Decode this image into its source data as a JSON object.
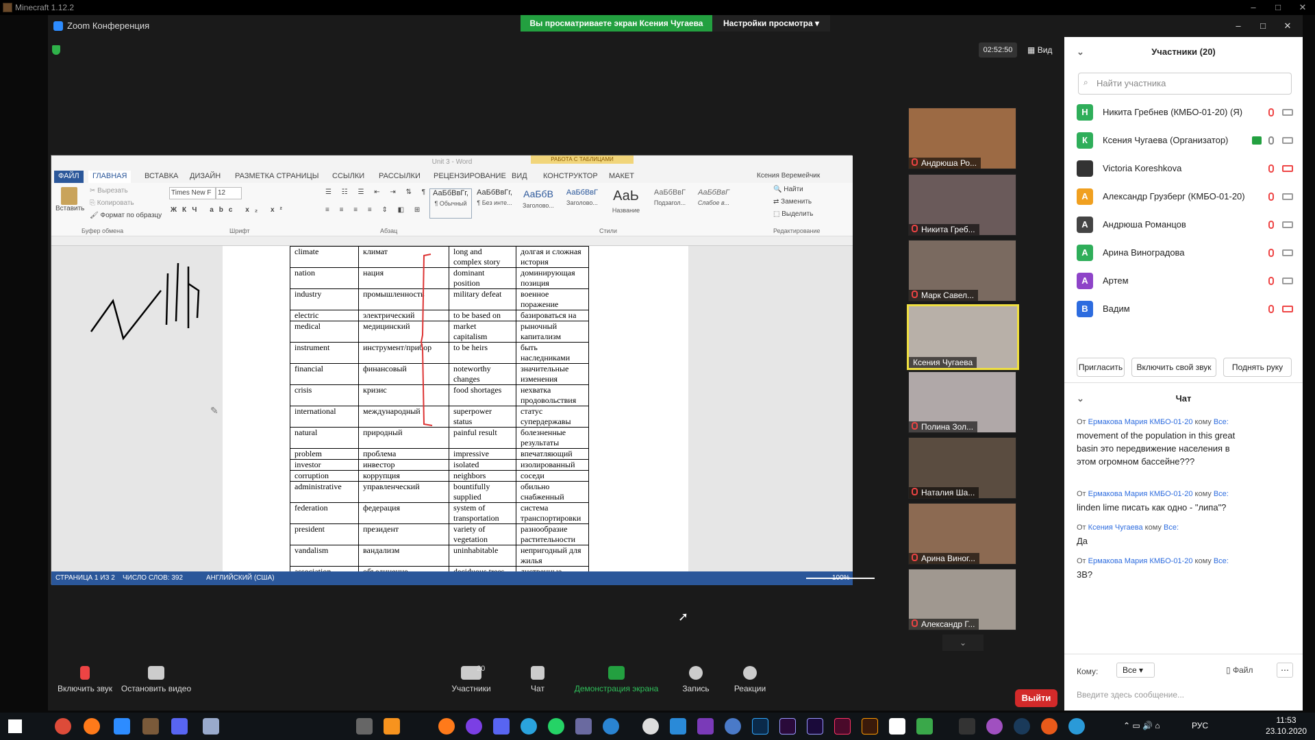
{
  "window": {
    "title": "Minecraft 1.12.2"
  },
  "zoom": {
    "title": "Zoom Конференция",
    "banner": "Вы просматриваете экран Ксения Чугаева",
    "view_settings": "Настройки просмотра",
    "timer": "02:52:50",
    "view": "Вид"
  },
  "word": {
    "title": "Unit 3 - Word",
    "ctx_tab": "РАБОТА С ТАБЛИЦАМИ",
    "user": "Ксения Веремейчик",
    "tabs": [
      "ФАЙЛ",
      "ГЛАВНАЯ",
      "ВСТАВКА",
      "ДИЗАЙН",
      "РАЗМЕТКА СТРАНИЦЫ",
      "ССЫЛКИ",
      "РАССЫЛКИ",
      "РЕЦЕНЗИРОВАНИЕ",
      "ВИД",
      "КОНСТРУКТОР",
      "МАКЕТ"
    ],
    "clipboard": {
      "paste": "Вставить",
      "cut": "Вырезать",
      "copy": "Копировать",
      "format": "Формат по образцу",
      "group": "Буфер обмена"
    },
    "font": {
      "name": "Times New F",
      "size": "12",
      "group": "Шрифт"
    },
    "para_group": "Абзац",
    "styles_group": "Стили",
    "edit_group": "Редактирование",
    "styles": [
      {
        "sample": "АаБбВвГг,",
        "name": "¶ Обычный"
      },
      {
        "sample": "АаБбВвГг,",
        "name": "¶ Без инте..."
      },
      {
        "sample": "АаБбВ",
        "name": "Заголово..."
      },
      {
        "sample": "АаБбВвГ",
        "name": "Заголово..."
      },
      {
        "sample": "АаЬ",
        "name": "Название"
      },
      {
        "sample": "АаБбВвГ",
        "name": "Подзагол..."
      },
      {
        "sample": "АаБбВвГ",
        "name": "Слабое в..."
      }
    ],
    "edit": {
      "find": "Найти",
      "replace": "Заменить",
      "select": "Выделить"
    },
    "status": {
      "page": "СТРАНИЦА 1 ИЗ 2",
      "words": "ЧИСЛО СЛОВ: 392",
      "lang": "АНГЛИЙСКИЙ (США)",
      "zoom": "100%"
    },
    "table": [
      [
        "climate",
        "климат",
        "long and complex story",
        "долгая и сложная история"
      ],
      [
        "nation",
        "нация",
        "dominant position",
        "доминирующая позиция"
      ],
      [
        "industry",
        "промышленность",
        "military defeat",
        "военное поражение"
      ],
      [
        "electric",
        "электрический",
        "to be based on",
        "базироваться на"
      ],
      [
        "medical",
        "медицинский",
        "market capitalism",
        "рыночный капитализм"
      ],
      [
        "instrument",
        "инструмент/прибор",
        "to be heirs",
        "быть наследниками"
      ],
      [
        "financial",
        "финансовый",
        "noteworthy changes",
        "значительные изменения"
      ],
      [
        "crisis",
        "кризис",
        "food shortages",
        "нехватка продовольствия"
      ],
      [
        "international",
        "международный",
        "superpower status",
        "статус супердержавы"
      ],
      [
        "natural",
        "природный",
        "painful result",
        "болезненные результаты"
      ],
      [
        "problem",
        "проблема",
        "impressive",
        "впечатляющий"
      ],
      [
        "investor",
        "инвестор",
        "isolated",
        "изолированный"
      ],
      [
        "corruption",
        "коррупция",
        "neighbors",
        "соседи"
      ],
      [
        "administrative",
        "управленческий",
        "bountifully supplied",
        "обильно снабженный"
      ],
      [
        "federation",
        "федерация",
        "system of transportation",
        "система транспортировки"
      ],
      [
        "president",
        "президент",
        "variety of vegetation",
        "разнообразие растительности"
      ],
      [
        "vandalism",
        "вандализм",
        "uninhabitable",
        "непригодный для жилья"
      ],
      [
        "association",
        "объединение",
        "deciduous trees",
        "лиственные деревья"
      ]
    ]
  },
  "videos": [
    "Андрюша Ро...",
    "Никита Греб...",
    "Марк Савел...",
    "Ксения Чугаева",
    "Полина Зол...",
    "Наталия Ша...",
    "Арина Виног...",
    "Александр Г..."
  ],
  "participants": {
    "title": "Участники (20)",
    "search": "Найти участника",
    "list": [
      {
        "initial": "Н",
        "name": "Никита Гребнев (КМБО-01-20) (Я)",
        "color": "#2fae5a"
      },
      {
        "initial": "К",
        "name": "Ксения Чугаева (Организатор)",
        "color": "#2fae5a"
      },
      {
        "initial": "",
        "name": "Victoria Koreshkova",
        "color": "#333333"
      },
      {
        "initial": "А",
        "name": "Александр Грузберг (КМБО-01-20)",
        "color": "#f0a020"
      },
      {
        "initial": "А",
        "name": "Андрюша Романцов",
        "color": "#444444"
      },
      {
        "initial": "А",
        "name": "Арина Виноградова",
        "color": "#2fae5a"
      },
      {
        "initial": "А",
        "name": "Артем",
        "color": "#8e44c8"
      },
      {
        "initial": "В",
        "name": "Вадим",
        "color": "#2d6cdf"
      }
    ],
    "invite": "Пригласить",
    "unmute": "Включить свой звук",
    "raise": "Поднять руку"
  },
  "chat": {
    "title": "Чат",
    "messages": [
      {
        "from": "От",
        "sender": "Ермакова Мария КМБО-01-20",
        "to": "кому",
        "target": "Все:",
        "text": "movement of the population in this great basin это передвижение населения в этом огромном бассейне???"
      },
      {
        "from": "От",
        "sender": "Ермакова Мария КМБО-01-20",
        "to": "кому",
        "target": "Все:",
        "text": "linden lime писать как одно - \"липа\"?"
      },
      {
        "from": "От",
        "sender": "Ксения Чугаева",
        "to": "кому",
        "target": "Все:",
        "text": "Да"
      },
      {
        "from": "От",
        "sender": "Ермакова Мария КМБО-01-20",
        "to": "кому",
        "target": "Все:",
        "text": "3В?"
      }
    ],
    "to_label": "Кому:",
    "to_value": "Все",
    "file": "Файл",
    "placeholder": "Введите здесь сообщение..."
  },
  "toolbar": {
    "mute": "Включить звук",
    "video": "Остановить видео",
    "participants": "Участники",
    "participants_count": "20",
    "chat": "Чат",
    "share": "Демонстрация экрана",
    "record": "Запись",
    "reactions": "Реакции",
    "leave": "Выйти"
  },
  "taskbar": {
    "lang": "РУС",
    "time": "11:53",
    "date": "23.10.2020"
  }
}
